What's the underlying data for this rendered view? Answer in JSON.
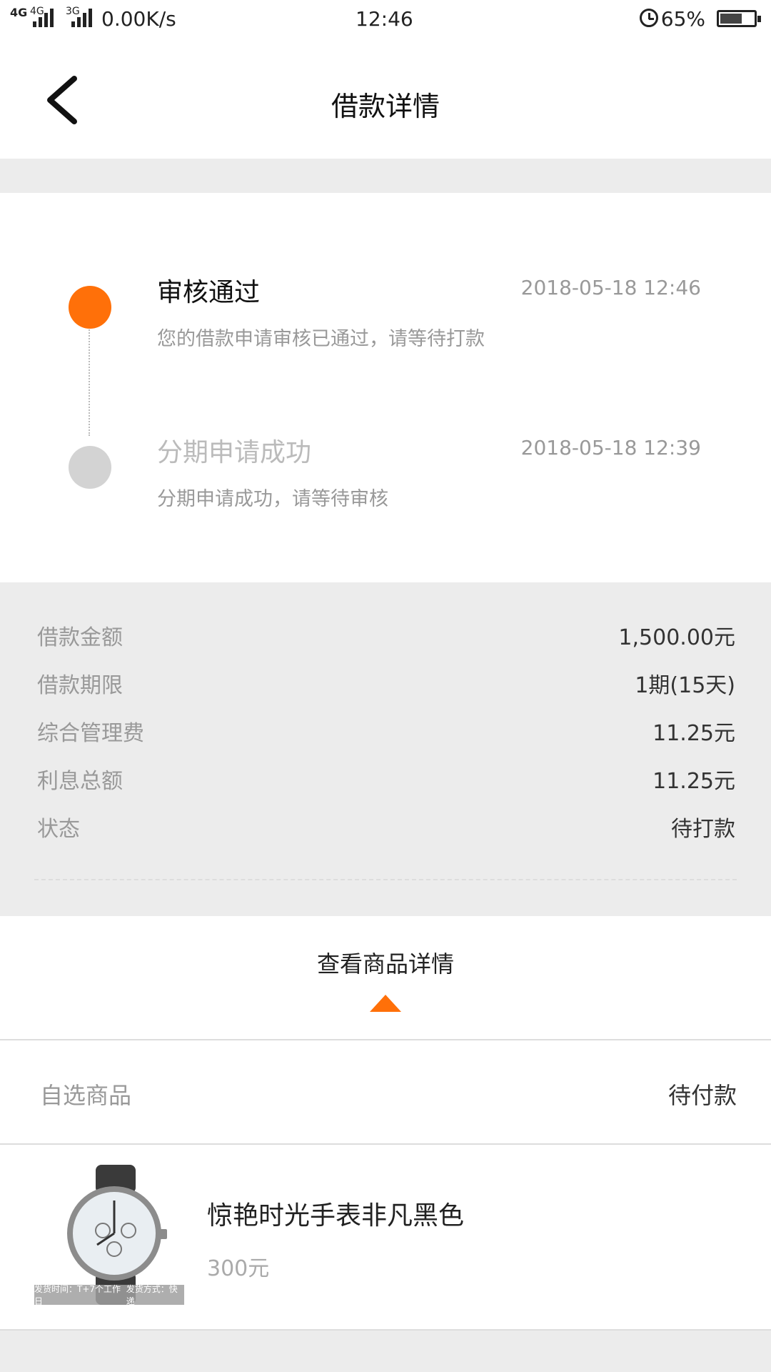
{
  "status_bar": {
    "network1": "4G",
    "network2": "4G",
    "network3": "3G",
    "speed": "0.00K/s",
    "time": "12:46",
    "battery": "65%"
  },
  "header": {
    "title": "借款详情"
  },
  "timeline": [
    {
      "title": "审核通过",
      "time": "2018-05-18 12:46",
      "desc": "您的借款申请审核已通过，请等待打款"
    },
    {
      "title": "分期申请成功",
      "time": "2018-05-18 12:39",
      "desc": "分期申请成功，请等待审核"
    }
  ],
  "details": [
    {
      "label": "借款金额",
      "value": "1,500.00元"
    },
    {
      "label": "借款期限",
      "value": "1期(15天)"
    },
    {
      "label": "综合管理费",
      "value": "11.25元"
    },
    {
      "label": "利息总额",
      "value": "11.25元"
    },
    {
      "label": "状态",
      "value": "待打款"
    }
  ],
  "toggle": {
    "label": "查看商品详情"
  },
  "product_section": {
    "title": "自选商品",
    "status": "待付款"
  },
  "product": {
    "name": "惊艳时光手表非凡黑色",
    "price": "300元",
    "image_caption_left": "发货时间：T+7个工作日",
    "image_caption_right": "发货方式：快递"
  },
  "colors": {
    "accent": "#ff7009",
    "inactive_dot": "#d3d3d3",
    "background": "#ececec"
  }
}
